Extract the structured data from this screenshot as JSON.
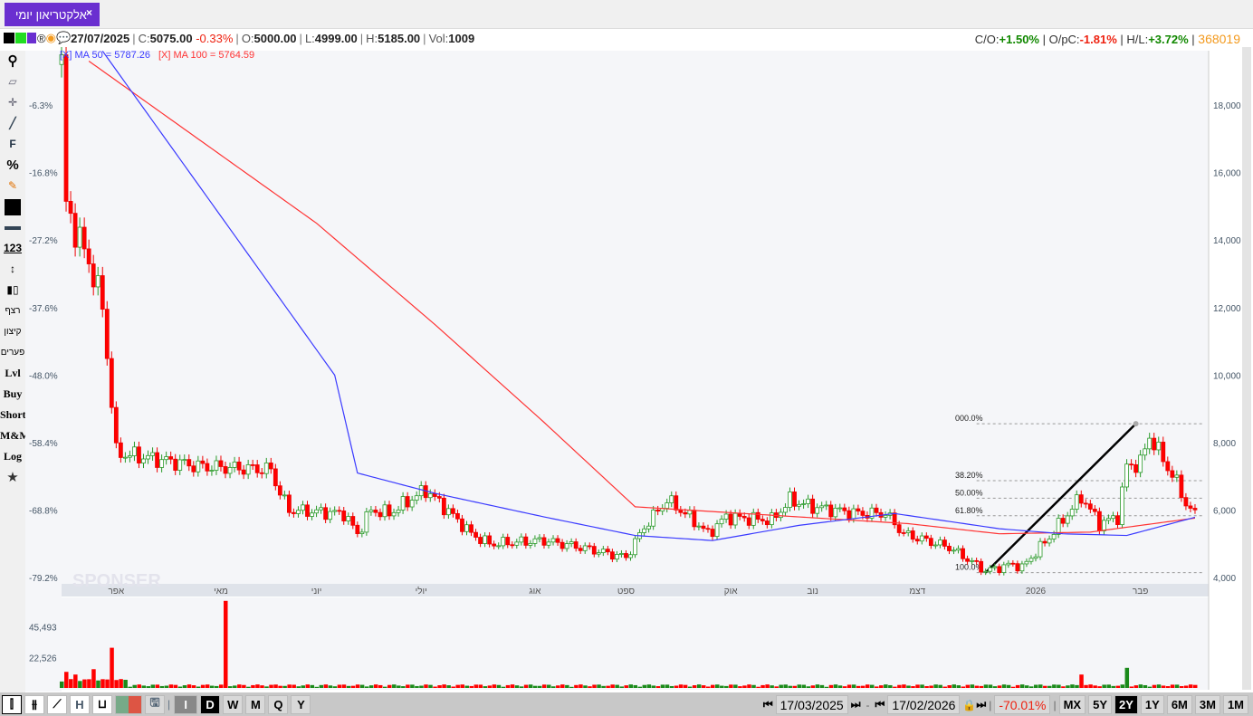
{
  "tab": {
    "title": "אלקטריאון יומי",
    "close": "×"
  },
  "info": {
    "date": "27/07/2025",
    "c_label": "C:",
    "close": "5075.00",
    "change": "-0.33%",
    "o_label": "O:",
    "open": "5000.00",
    "l_label": "L:",
    "low": "4999.00",
    "h_label": "H:",
    "high": "5185.00",
    "vol_label": "Vol:",
    "vol": "1009",
    "co_label": "C/O:",
    "co": "+1.50%",
    "opc_label": "O/pC:",
    "opc": "-1.81%",
    "hl_label": "H/L:",
    "hl": "+3.72%",
    "id": "368019"
  },
  "ma": {
    "ma50": "[X] MA 50 = 5787.26",
    "ma100": "[X] MA 100 = 5764.59",
    "ma50_color": "#3a3aff",
    "ma100_color": "#ff3333"
  },
  "left_toolbar": [
    "search-icon",
    "eraser-icon",
    "crosshair-icon",
    "line-icon",
    "F",
    "%",
    "edit-icon",
    "color-box",
    "line-width-icon",
    "123",
    "vertical-arrow-icon",
    "candles-icon",
    "רצף",
    "קיצון",
    "פערים",
    "Lvl",
    "Buy",
    "Short",
    "M&M",
    "Log",
    "star-icon"
  ],
  "toolbar_labels": {
    "f": "F",
    "pct": "%",
    "num": "123",
    "rezef": "רצף",
    "kitzon": "קיצון",
    "paarim": "פערים",
    "lvl": "Lvl",
    "buy": "Buy",
    "short": "Short",
    "mm": "M&M",
    "log": "Log"
  },
  "chart_data": {
    "type": "candlestick",
    "y_ticks": [
      18000,
      16000,
      14000,
      12000,
      10000,
      8000,
      6000,
      4000
    ],
    "y_tick_labels": [
      "18,000",
      "16,000",
      "14,000",
      "12,000",
      "10,000",
      "8,000",
      "6,000",
      "4,000"
    ],
    "pct_ticks": [
      "-6.3%",
      "-16.8%",
      "-27.2%",
      "-37.6%",
      "-48.0%",
      "-58.4%",
      "-68.8%",
      "-79.2%"
    ],
    "months": [
      {
        "label": "אפר",
        "i": 12
      },
      {
        "label": "מאי",
        "i": 35
      },
      {
        "label": "יוני",
        "i": 56
      },
      {
        "label": "יולי",
        "i": 79
      },
      {
        "label": "אוג",
        "i": 104
      },
      {
        "label": "ספט",
        "i": 124
      },
      {
        "label": "אוק",
        "i": 147
      },
      {
        "label": "נוב",
        "i": 165
      },
      {
        "label": "דצמ",
        "i": 188
      },
      {
        "label": "2026",
        "i": 214
      },
      {
        "label": "פבר",
        "i": 237
      }
    ],
    "n": 250,
    "price_path": [
      [
        0,
        19200
      ],
      [
        1,
        15000
      ],
      [
        4,
        14000
      ],
      [
        7,
        13000
      ],
      [
        9,
        12000
      ],
      [
        11,
        9200
      ],
      [
        12,
        7700
      ],
      [
        26,
        7400
      ],
      [
        30,
        7300
      ],
      [
        46,
        7200
      ],
      [
        48,
        6500
      ],
      [
        50,
        6000
      ],
      [
        62,
        5900
      ],
      [
        65,
        5300
      ],
      [
        68,
        6000
      ],
      [
        72,
        5900
      ],
      [
        80,
        6600
      ],
      [
        84,
        6100
      ],
      [
        90,
        5300
      ],
      [
        94,
        5000
      ],
      [
        106,
        5100
      ],
      [
        114,
        4900
      ],
      [
        124,
        4600
      ],
      [
        128,
        5500
      ],
      [
        133,
        6300
      ],
      [
        138,
        5800
      ],
      [
        142,
        5300
      ],
      [
        146,
        5800
      ],
      [
        156,
        5700
      ],
      [
        160,
        6300
      ],
      [
        165,
        6100
      ],
      [
        175,
        5900
      ],
      [
        181,
        5900
      ],
      [
        185,
        5300
      ],
      [
        195,
        4900
      ],
      [
        203,
        4200
      ],
      [
        209,
        4400
      ],
      [
        211,
        4300
      ],
      [
        217,
        5200
      ],
      [
        224,
        6400
      ],
      [
        228,
        5600
      ],
      [
        232,
        5800
      ],
      [
        234,
        7300
      ],
      [
        237,
        7400
      ],
      [
        239,
        8200
      ],
      [
        242,
        7500
      ],
      [
        245,
        6800
      ],
      [
        247,
        6200
      ],
      [
        249,
        5850
      ]
    ],
    "ma50_path": [
      [
        9,
        19600
      ],
      [
        60,
        10000
      ],
      [
        65,
        7100
      ],
      [
        82,
        6500
      ],
      [
        106,
        5800
      ],
      [
        126,
        5250
      ],
      [
        143,
        5100
      ],
      [
        162,
        5550
      ],
      [
        183,
        5900
      ],
      [
        206,
        5450
      ],
      [
        220,
        5300
      ],
      [
        234,
        5250
      ],
      [
        249,
        5790
      ]
    ],
    "ma100_path": [
      [
        6,
        19300
      ],
      [
        56,
        14500
      ],
      [
        82,
        11500
      ],
      [
        106,
        8600
      ],
      [
        126,
        6100
      ],
      [
        186,
        5600
      ],
      [
        206,
        5300
      ],
      [
        226,
        5350
      ],
      [
        249,
        5765
      ]
    ],
    "volume_ticks": [
      "45,493",
      "22,526"
    ],
    "volume_ticks_values": [
      45493,
      22526
    ],
    "volume_spikes": [
      [
        11,
        30000
      ],
      [
        36,
        65000
      ],
      [
        1,
        12000
      ],
      [
        3,
        10000
      ],
      [
        7,
        14000
      ],
      [
        234,
        15000
      ],
      [
        224,
        10000
      ]
    ],
    "fib": {
      "levels": [
        {
          "label": "000.0%",
          "price": 8560
        },
        {
          "label": "38.20%",
          "price": 6875
        },
        {
          "label": "50.00%",
          "price": 6355
        },
        {
          "label": "61.80%",
          "price": 5835
        },
        {
          "label": "100.0%",
          "price": 4150
        }
      ],
      "from": [
        203,
        4150
      ],
      "to": [
        236,
        8560
      ]
    }
  },
  "bottom": {
    "periods": [
      "I",
      "D",
      "W",
      "M",
      "Q",
      "Y"
    ],
    "active_period": "D",
    "start": "17/03/2025",
    "end": "17/02/2026",
    "dash": "-",
    "change": "-70.01%",
    "ranges": [
      "MX",
      "5Y",
      "2Y",
      "1Y",
      "6M",
      "3M",
      "1M"
    ],
    "active_range": "2Y",
    "watermark": "SPONSER"
  }
}
